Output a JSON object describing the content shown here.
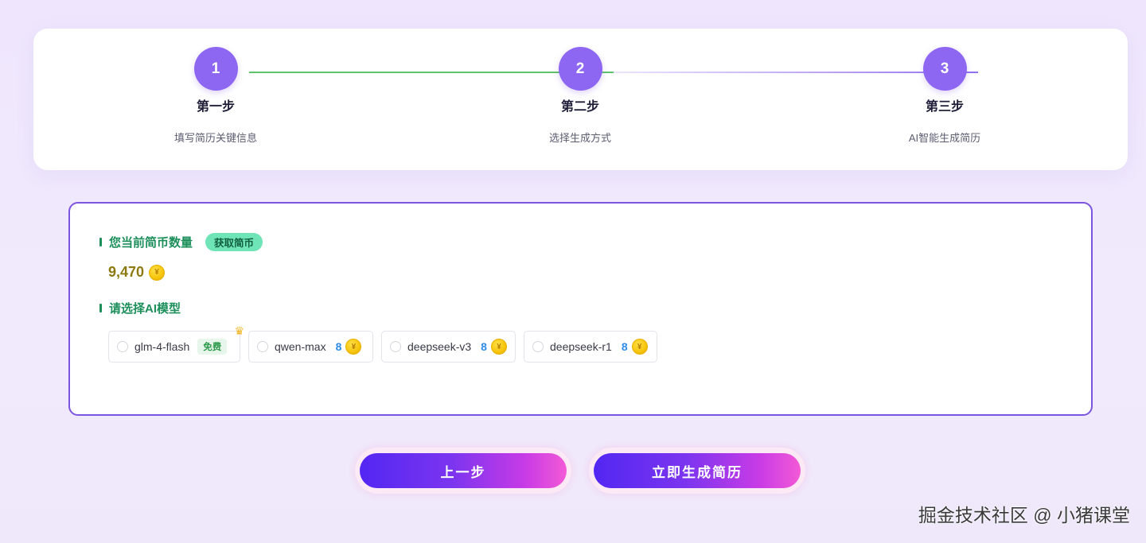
{
  "steps": [
    {
      "number": "1",
      "title": "第一步",
      "desc": "填写简历关键信息"
    },
    {
      "number": "2",
      "title": "第二步",
      "desc": "选择生成方式"
    },
    {
      "number": "3",
      "title": "第三步",
      "desc": "AI智能生成简历"
    }
  ],
  "coins": {
    "label": "您当前简币数量",
    "get_button": "获取简币",
    "count": "9,470",
    "icon": "coin-icon"
  },
  "models": {
    "label": "请选择AI模型",
    "options": [
      {
        "name": "glm-4-flash",
        "badge": "免费",
        "icon": "crown-icon"
      },
      {
        "name": "qwen-max",
        "price": "8"
      },
      {
        "name": "deepseek-v3",
        "price": "8"
      },
      {
        "name": "deepseek-r1",
        "price": "8"
      }
    ]
  },
  "buttons": {
    "prev": "上一步",
    "generate": "立即生成简历"
  },
  "watermark": "掘金技术社区 @ 小猪课堂",
  "colors": {
    "accent": "#8d67f2",
    "success": "#1c8f5a",
    "price": "#2f8ce6",
    "coin": "#f6c40b"
  }
}
